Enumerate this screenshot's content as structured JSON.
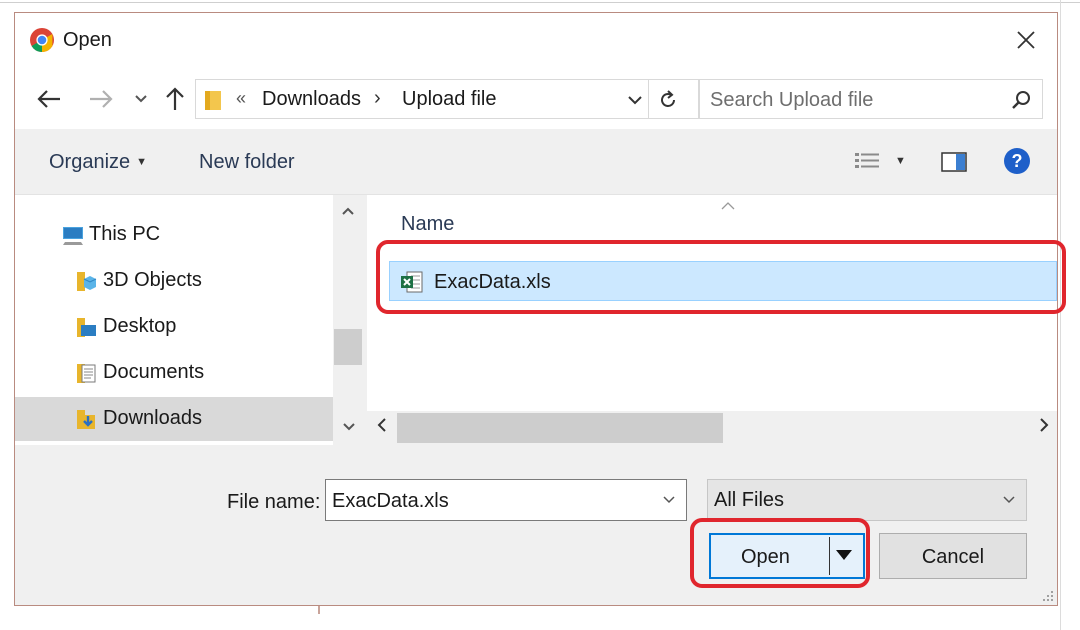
{
  "window": {
    "title": "Open",
    "app_icon": "chrome-icon",
    "close_icon": "close-icon"
  },
  "navigation": {
    "back_icon": "back-arrow-icon",
    "forward_icon": "forward-arrow-icon",
    "recent_icon": "chevron-down-icon",
    "up_icon": "up-arrow-icon"
  },
  "address_bar": {
    "overflow_glyph": "«",
    "breadcrumbs": [
      "Downloads",
      "Upload file"
    ],
    "separator": "›",
    "dropdown_icon": "chevron-down-icon",
    "refresh_icon": "refresh-icon"
  },
  "search": {
    "placeholder": "Search Upload file",
    "icon": "search-icon"
  },
  "toolbar": {
    "organize_label": "Organize",
    "new_folder_label": "New folder",
    "view_icon": "details-view-icon",
    "preview_icon": "preview-pane-icon",
    "help_icon": "help-icon",
    "help_glyph": "?"
  },
  "nav_pane": {
    "items": [
      {
        "label": "This PC",
        "icon": "computer-icon",
        "selected": false
      },
      {
        "label": "3D Objects",
        "icon": "3d-objects-folder-icon",
        "selected": false
      },
      {
        "label": "Desktop",
        "icon": "desktop-folder-icon",
        "selected": false
      },
      {
        "label": "Documents",
        "icon": "documents-folder-icon",
        "selected": false
      },
      {
        "label": "Downloads",
        "icon": "downloads-folder-icon",
        "selected": true
      }
    ]
  },
  "file_list": {
    "sort_indicator": "^",
    "column_name": "Name",
    "files": [
      {
        "name": "ExacData.xls",
        "icon": "excel-file-icon",
        "selected": true
      }
    ]
  },
  "footer": {
    "file_name_label": "File name:",
    "file_name_value": "ExacData.xls",
    "file_type_value": "All Files",
    "open_label": "Open",
    "cancel_label": "Cancel"
  },
  "colors": {
    "selection": "#cce8ff",
    "annotation": "#e0262d",
    "help_blue": "#1e5fc9"
  }
}
